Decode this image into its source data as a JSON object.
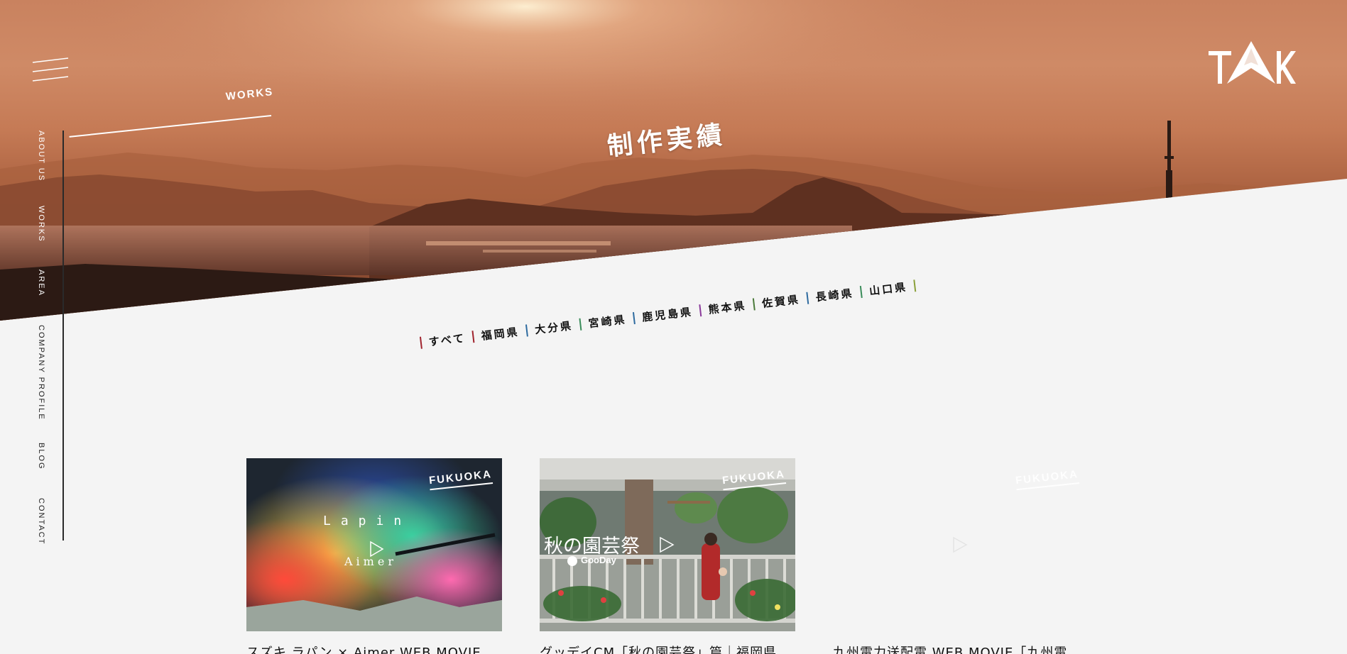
{
  "header": {
    "menu_icon": "hamburger-icon",
    "logo_text": "TAK"
  },
  "hero": {
    "section_tag": "WORKS",
    "title": "制作実績"
  },
  "nav": {
    "items": [
      "ABOUT US",
      "WORKS",
      "AREA",
      "COMPANY PROFILE",
      "BLOG",
      "CONTACT"
    ]
  },
  "filter": {
    "options": [
      "すべて",
      "福岡県",
      "大分県",
      "宮崎県",
      "鹿児島県",
      "熊本県",
      "佐賀県",
      "長崎県",
      "山口県"
    ]
  },
  "works": [
    {
      "area": "FUKUOKA",
      "title": "スズキ ラパン × Aimer WEB MOVIE",
      "thumb_logo": "Lapin",
      "thumb_artist": "Aimer"
    },
    {
      "area": "FUKUOKA",
      "title": "グッデイCM「秋の園芸祭」篇｜福岡県",
      "thumb_caption": "秋の園芸祭",
      "thumb_brand": "GooDay"
    },
    {
      "area": "FUKUOKA",
      "title": "九州電力送配電 WEB MOVIE「九州電"
    }
  ],
  "colors": {
    "background": "#f4f4f4",
    "text": "#111111",
    "filter_separators": [
      "#a0232d",
      "#a0232d",
      "#2d6a9f",
      "#3a8c5a",
      "#2d6a9f",
      "#8a3a9a",
      "#4a7a3a",
      "#2d6a9f",
      "#3a8c5a",
      "#8aa03a"
    ]
  }
}
